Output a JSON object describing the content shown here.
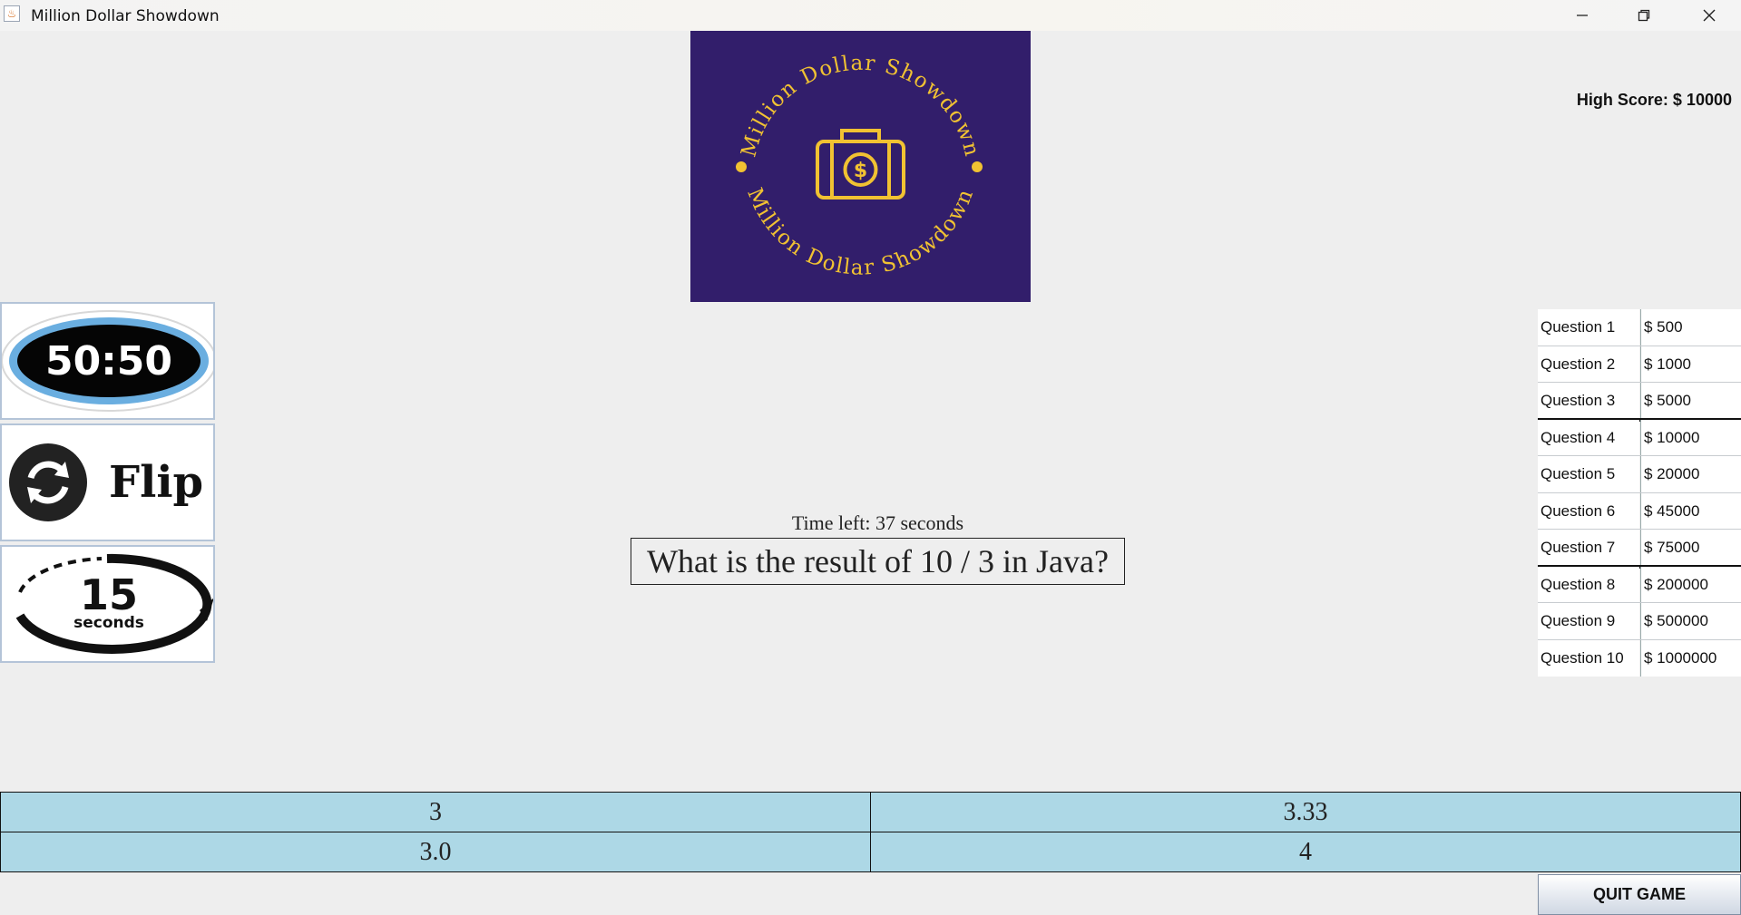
{
  "window": {
    "title": "Million Dollar Showdown",
    "minimize_glyph": "─",
    "maximize_glyph": "❐",
    "close_glyph": "✕"
  },
  "logo": {
    "text": "Million Dollar Showdown",
    "background_color": "#321e6b",
    "accent_color": "#f1c232"
  },
  "high_score": "High Score: $ 10000",
  "lifelines": [
    {
      "label": "50:50",
      "icon": "fifty-fifty-icon"
    },
    {
      "label": "Flip",
      "icon": "flip-icon"
    },
    {
      "label": "15",
      "sublabel": "seconds",
      "icon": "timer-15-seconds-icon"
    }
  ],
  "timer": "Time left: 37 seconds",
  "question": "What is the result of 10 / 3 in Java?",
  "ladder": [
    {
      "question": "Question 1",
      "prize": "$ 500"
    },
    {
      "question": "Question 2",
      "prize": "$ 1000"
    },
    {
      "question": "Question 3",
      "prize": "$ 5000",
      "milestone": true
    },
    {
      "question": "Question 4",
      "prize": "$ 10000"
    },
    {
      "question": "Question 5",
      "prize": "$ 20000"
    },
    {
      "question": "Question 6",
      "prize": "$ 45000"
    },
    {
      "question": "Question 7",
      "prize": "$ 75000",
      "milestone": true
    },
    {
      "question": "Question 8",
      "prize": "$ 200000"
    },
    {
      "question": "Question 9",
      "prize": "$ 500000"
    },
    {
      "question": "Question 10",
      "prize": "$ 1000000"
    }
  ],
  "answers": [
    "3",
    "3.33",
    "3.0",
    "4"
  ],
  "answer_color": "#add8e6",
  "quit_label": "QUIT GAME"
}
